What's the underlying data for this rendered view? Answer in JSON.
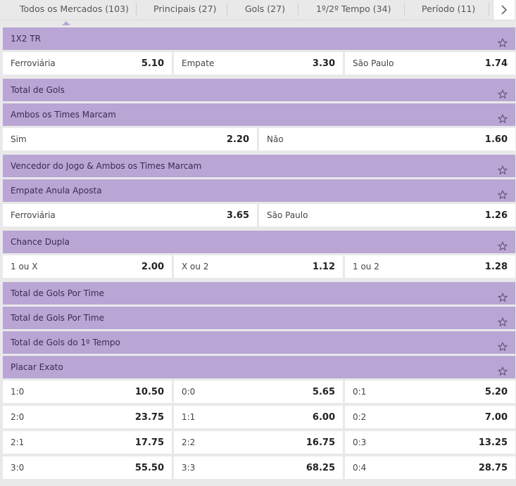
{
  "tabs": [
    {
      "label": "Todos os Mercados (103)"
    },
    {
      "label": "Principais (27)"
    },
    {
      "label": "Gols (27)"
    },
    {
      "label": "1º/2º Tempo (34)"
    },
    {
      "label": "Período (11)"
    }
  ],
  "colors": {
    "header_bg": "#b9a6d4",
    "page_bg": "#e9e9e9",
    "cell_bg": "#ffffff"
  },
  "markets": [
    {
      "title": "1X2 TR",
      "rows": [
        [
          {
            "label": "Ferroviária",
            "odd": "5.10"
          },
          {
            "label": "Empate",
            "odd": "3.30"
          },
          {
            "label": "São Paulo",
            "odd": "1.74"
          }
        ]
      ]
    },
    {
      "title": "Total de Gols",
      "rows": []
    },
    {
      "title": "Ambos os Times Marcam",
      "rows": [
        [
          {
            "label": "Sim",
            "odd": "2.20"
          },
          {
            "label": "Não",
            "odd": "1.60"
          }
        ]
      ]
    },
    {
      "title": "Vencedor do Jogo & Ambos os Times Marcam",
      "rows": []
    },
    {
      "title": "Empate Anula Aposta",
      "rows": [
        [
          {
            "label": "Ferroviária",
            "odd": "3.65"
          },
          {
            "label": "São Paulo",
            "odd": "1.26"
          }
        ]
      ]
    },
    {
      "title": "Chance Dupla",
      "rows": [
        [
          {
            "label": "1 ou X",
            "odd": "2.00"
          },
          {
            "label": "X ou 2",
            "odd": "1.12"
          },
          {
            "label": "1 ou 2",
            "odd": "1.28"
          }
        ]
      ]
    },
    {
      "title": "Total de Gols Por Time",
      "rows": []
    },
    {
      "title": "Total de Gols Por Time",
      "rows": []
    },
    {
      "title": "Total de Gols do 1º Tempo",
      "rows": []
    },
    {
      "title": "Placar Exato",
      "rows": [
        [
          {
            "label": "1:0",
            "odd": "10.50"
          },
          {
            "label": "0:0",
            "odd": "5.65"
          },
          {
            "label": "0:1",
            "odd": "5.20"
          }
        ],
        [
          {
            "label": "2:0",
            "odd": "23.75"
          },
          {
            "label": "1:1",
            "odd": "6.00"
          },
          {
            "label": "0:2",
            "odd": "7.00"
          }
        ],
        [
          {
            "label": "2:1",
            "odd": "17.75"
          },
          {
            "label": "2:2",
            "odd": "16.75"
          },
          {
            "label": "0:3",
            "odd": "13.25"
          }
        ],
        [
          {
            "label": "3:0",
            "odd": "55.50"
          },
          {
            "label": "3:3",
            "odd": "68.25"
          },
          {
            "label": "0:4",
            "odd": "28.75"
          }
        ]
      ]
    }
  ]
}
